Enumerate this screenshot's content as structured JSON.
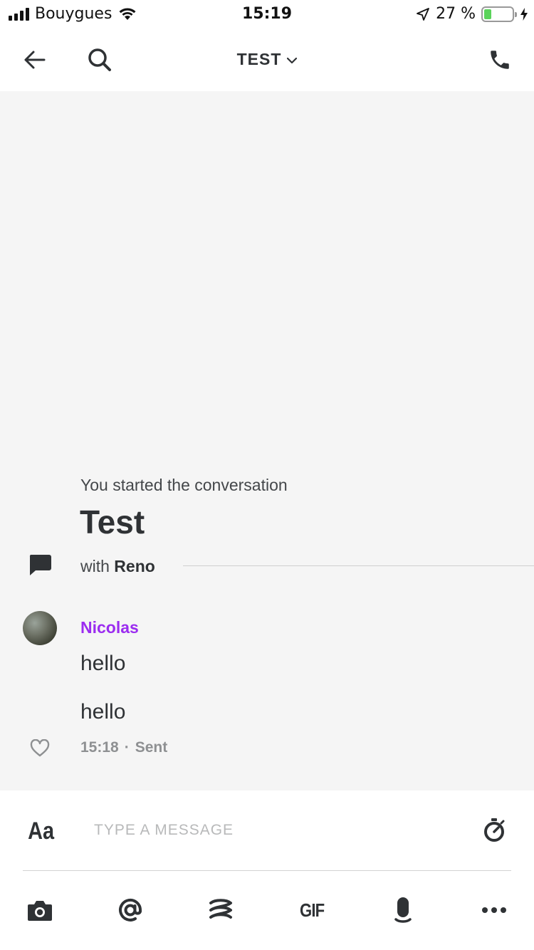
{
  "status_bar": {
    "carrier": "Bouygues",
    "time": "15:19",
    "battery": "27 %",
    "battery_level": 0.27
  },
  "header": {
    "title": "TEST",
    "icons": [
      "back-arrow-icon",
      "search-icon",
      "chevron-down-icon",
      "phone-icon"
    ]
  },
  "conversation": {
    "started_text": "You started the conversation",
    "title": "Test",
    "with_prefix": "with",
    "with_name": "Reno"
  },
  "messages": {
    "sender": "Nicolas",
    "sender_color": "#9b2cf0",
    "items": [
      "hello",
      "hello"
    ],
    "time": "15:18",
    "separator": "·",
    "status": "Sent"
  },
  "composer": {
    "placeholder": "TYPE A MESSAGE",
    "format_label": "Aa",
    "gif_label": "GIF",
    "toolbar_icons": [
      "camera-icon",
      "mention-icon",
      "ping-icon",
      "gif-icon",
      "microphone-icon",
      "more-icon"
    ]
  },
  "colors": {
    "background": "#f5f5f5",
    "text": "#2f3235",
    "accent": "#9b2cf0"
  }
}
